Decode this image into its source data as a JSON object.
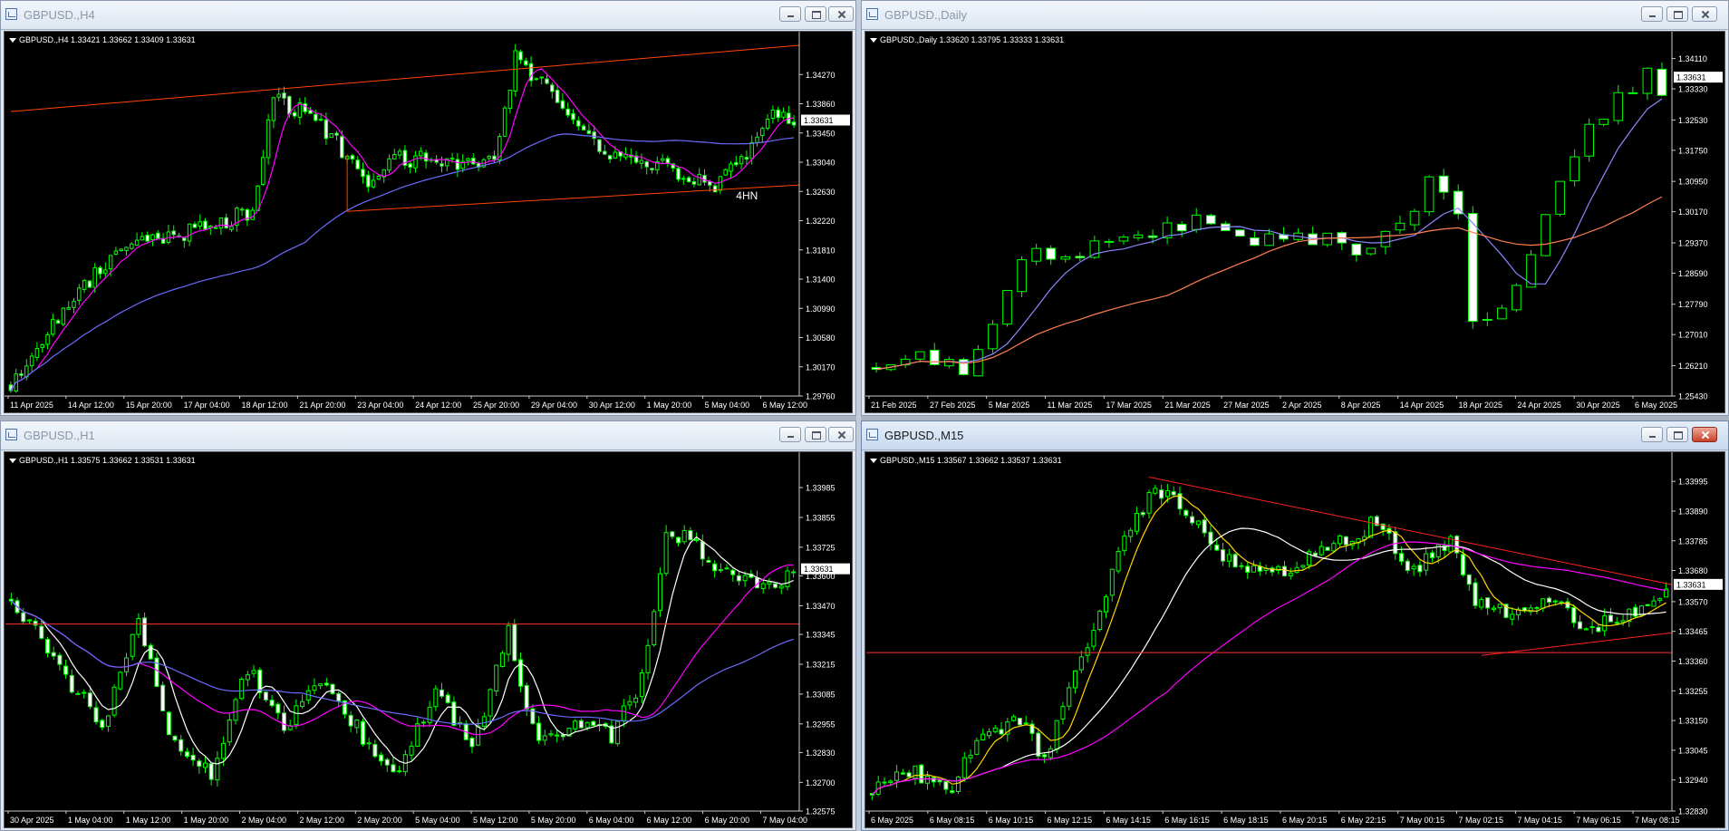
{
  "colors": {
    "bull": "#00ff00",
    "bear": "#ffffff",
    "axis_text": "#ffffff",
    "grid": "#444444"
  },
  "windows": [
    {
      "key": "h4",
      "title": "GBPUSD.,H4",
      "active": false,
      "chart_data": {
        "type": "candlestick",
        "title": "GBPUSD.,H4  1.33421 1.33662 1.33409 1.33631",
        "current_price": "1.33631",
        "y_ticks": [
          "1.34270",
          "1.33860",
          "1.33450",
          "1.33040",
          "1.32630",
          "1.32220",
          "1.31810",
          "1.31400",
          "1.30990",
          "1.30580",
          "1.30170",
          "1.29760"
        ],
        "ylim": [
          1.2976,
          1.3468
        ],
        "x_ticks": [
          "11 Apr 2025",
          "14 Apr 12:00",
          "15 Apr 20:00",
          "17 Apr 04:00",
          "18 Apr 12:00",
          "21 Apr 20:00",
          "23 Apr 04:00",
          "24 Apr 12:00",
          "25 Apr 20:00",
          "29 Apr 04:00",
          "30 Apr 12:00",
          "1 May 20:00",
          "5 May 04:00",
          "6 May 12:00"
        ],
        "candle_count": 150,
        "price_path": [
          [
            0,
            1.299
          ],
          [
            6,
            1.306
          ],
          [
            14,
            1.313
          ],
          [
            22,
            1.3185
          ],
          [
            30,
            1.32
          ],
          [
            38,
            1.3215
          ],
          [
            46,
            1.3235
          ],
          [
            50,
            1.339
          ],
          [
            56,
            1.3375
          ],
          [
            62,
            1.333
          ],
          [
            68,
            1.327
          ],
          [
            74,
            1.331
          ],
          [
            84,
            1.3305
          ],
          [
            92,
            1.33
          ],
          [
            96,
            1.345
          ],
          [
            104,
            1.339
          ],
          [
            110,
            1.334
          ],
          [
            116,
            1.331
          ],
          [
            124,
            1.33
          ],
          [
            134,
            1.327
          ],
          [
            140,
            1.331
          ],
          [
            144,
            1.3375
          ],
          [
            150,
            1.3363
          ]
        ],
        "ma_fast_color": "#ff00ff",
        "ma_slow_color": "#6b6bff",
        "trendlines": [
          {
            "color": "#ff4500",
            "points": [
              [
                0,
                1.3375
              ],
              [
                150,
                1.3468
              ]
            ]
          },
          {
            "color": "#ff4500",
            "points": [
              [
                64,
                1.3235
              ],
              [
                150,
                1.3272
              ]
            ]
          },
          {
            "color": "#ff4500",
            "points": [
              [
                64,
                1.3235
              ],
              [
                64,
                1.3315
              ]
            ]
          }
        ],
        "annotation": {
          "text": "4HN",
          "index": 138,
          "price": 1.3252
        }
      }
    },
    {
      "key": "daily",
      "title": "GBPUSD.,Daily",
      "active": false,
      "chart_data": {
        "type": "candlestick",
        "title": "GBPUSD.,Daily  1.33620 1.33795 1.33333 1.33631",
        "current_price": "1.33631",
        "y_ticks": [
          "1.34110",
          "1.33330",
          "1.32530",
          "1.31750",
          "1.30950",
          "1.30170",
          "1.29370",
          "1.28590",
          "1.27790",
          "1.27010",
          "1.26210",
          "1.25430"
        ],
        "ylim": [
          1.2543,
          1.3445
        ],
        "x_ticks": [
          "21 Feb 2025",
          "27 Feb 2025",
          "5 Mar 2025",
          "11 Mar 2025",
          "17 Mar 2025",
          "21 Mar 2025",
          "27 Mar 2025",
          "2 Apr 2025",
          "8 Apr 2025",
          "14 Apr 2025",
          "18 Apr 2025",
          "24 Apr 2025",
          "30 Apr 2025",
          "6 May 2025"
        ],
        "candle_count": 55,
        "price_path": [
          [
            0,
            1.262
          ],
          [
            4,
            1.264
          ],
          [
            6,
            1.259
          ],
          [
            8,
            1.274
          ],
          [
            10,
            1.29
          ],
          [
            14,
            1.292
          ],
          [
            18,
            1.296
          ],
          [
            22,
            1.299
          ],
          [
            26,
            1.294
          ],
          [
            30,
            1.295
          ],
          [
            34,
            1.292
          ],
          [
            36,
            1.298
          ],
          [
            38,
            1.31
          ],
          [
            40,
            1.302
          ],
          [
            41,
            1.273
          ],
          [
            43,
            1.278
          ],
          [
            45,
            1.29
          ],
          [
            47,
            1.309
          ],
          [
            49,
            1.322
          ],
          [
            51,
            1.331
          ],
          [
            53,
            1.338
          ],
          [
            55,
            1.328
          ],
          [
            57,
            1.335
          ],
          [
            59,
            1.339
          ],
          [
            61,
            1.333
          ],
          [
            63,
            1.33
          ],
          [
            65,
            1.336
          ]
        ],
        "ma_fast_color": "#8a8aff",
        "ma_slow_color": "#ff7f50"
      }
    },
    {
      "key": "h1",
      "title": "GBPUSD.,H1",
      "active": false,
      "chart_data": {
        "type": "candlestick",
        "title": "GBPUSD.,H1  1.33575 1.33662 1.33531 1.33631",
        "current_price": "1.33631",
        "y_ticks": [
          "1.33985",
          "1.33855",
          "1.33725",
          "1.33600",
          "1.33470",
          "1.33345",
          "1.33215",
          "1.33085",
          "1.32955",
          "1.32830",
          "1.32700",
          "1.32575"
        ],
        "ylim": [
          1.32575,
          1.3408
        ],
        "x_ticks": [
          "30 Apr 2025",
          "1 May 04:00",
          "1 May 12:00",
          "1 May 20:00",
          "2 May 04:00",
          "2 May 12:00",
          "2 May 20:00",
          "5 May 04:00",
          "5 May 12:00",
          "5 May 20:00",
          "6 May 04:00",
          "6 May 12:00",
          "6 May 20:00",
          "7 May 04:00"
        ],
        "candle_count": 130,
        "price_path": [
          [
            0,
            1.335
          ],
          [
            8,
            1.332
          ],
          [
            15,
            1.3295
          ],
          [
            21,
            1.334
          ],
          [
            27,
            1.3285
          ],
          [
            33,
            1.3275
          ],
          [
            39,
            1.332
          ],
          [
            45,
            1.3295
          ],
          [
            52,
            1.3315
          ],
          [
            58,
            1.329
          ],
          [
            64,
            1.3275
          ],
          [
            70,
            1.331
          ],
          [
            76,
            1.3285
          ],
          [
            82,
            1.3335
          ],
          [
            87,
            1.3285
          ],
          [
            93,
            1.3295
          ],
          [
            99,
            1.329
          ],
          [
            104,
            1.3315
          ],
          [
            108,
            1.338
          ],
          [
            112,
            1.3375
          ],
          [
            118,
            1.336
          ],
          [
            124,
            1.3355
          ],
          [
            130,
            1.3363
          ]
        ],
        "ma_fast_color": "#ffffff",
        "ma_mid_color": "#ff00ff",
        "ma_slow_color": "#6b6bff",
        "hline": {
          "price": 1.3339,
          "color": "#ff3030"
        }
      }
    },
    {
      "key": "m15",
      "title": "GBPUSD.,M15",
      "active": true,
      "chart_data": {
        "type": "candlestick",
        "title": "GBPUSD.,M15  1.33567 1.33662 1.33537 1.33631",
        "current_price": "1.33631",
        "y_ticks": [
          "1.33995",
          "1.33890",
          "1.33785",
          "1.33680",
          "1.33570",
          "1.33465",
          "1.33360",
          "1.33255",
          "1.33150",
          "1.33045",
          "1.32940",
          "1.32830"
        ],
        "ylim": [
          1.3283,
          1.3405
        ],
        "x_ticks": [
          "6 May 2025",
          "6 May 08:15",
          "6 May 10:15",
          "6 May 12:15",
          "6 May 14:15",
          "6 May 16:15",
          "6 May 18:15",
          "6 May 20:15",
          "6 May 22:15",
          "7 May 00:15",
          "7 May 02:15",
          "7 May 04:15",
          "7 May 06:15",
          "7 May 08:15"
        ],
        "candle_count": 130,
        "price_path": [
          [
            0,
            1.3289
          ],
          [
            6,
            1.3298
          ],
          [
            12,
            1.3289
          ],
          [
            18,
            1.3309
          ],
          [
            24,
            1.3315
          ],
          [
            28,
            1.3302
          ],
          [
            34,
            1.3335
          ],
          [
            40,
            1.3375
          ],
          [
            46,
            1.3398
          ],
          [
            52,
            1.3386
          ],
          [
            58,
            1.3372
          ],
          [
            64,
            1.3366
          ],
          [
            70,
            1.3372
          ],
          [
            76,
            1.3378
          ],
          [
            82,
            1.3385
          ],
          [
            88,
            1.3368
          ],
          [
            94,
            1.3378
          ],
          [
            98,
            1.3358
          ],
          [
            104,
            1.3352
          ],
          [
            110,
            1.3358
          ],
          [
            116,
            1.3348
          ],
          [
            122,
            1.3352
          ],
          [
            128,
            1.3358
          ],
          [
            130,
            1.3363
          ]
        ],
        "ma_fast_color": "#ffd700",
        "ma_mid_color": "#ffffff",
        "ma_slow_color": "#ff00ff",
        "hline": {
          "price": 1.3339,
          "color": "#ff3030"
        },
        "trendlines": [
          {
            "color": "#ff2020",
            "points": [
              [
                45,
                1.3401
              ],
              [
                130,
                1.3363
              ]
            ]
          },
          {
            "color": "#ff2020",
            "points": [
              [
                99,
                1.3338
              ],
              [
                130,
                1.3346
              ]
            ]
          }
        ]
      }
    }
  ]
}
